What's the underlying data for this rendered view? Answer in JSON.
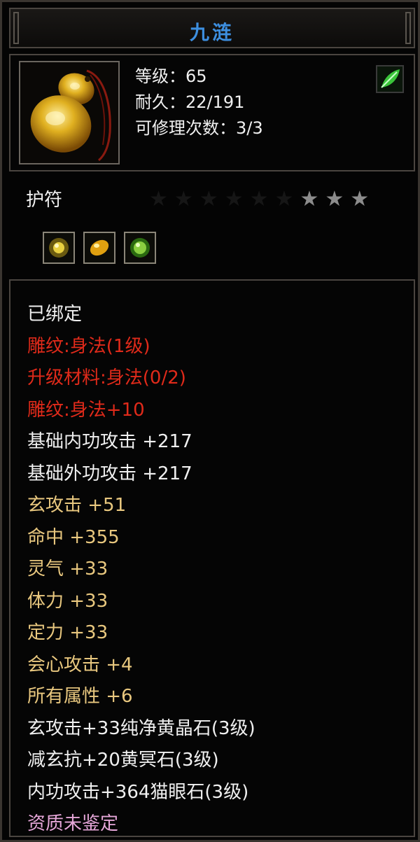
{
  "title": "九涟",
  "item": {
    "level": "等级：65",
    "durability": "耐久：22/191",
    "repairs": "可修理次数：3/3",
    "icon": "amber-gourd-amulet",
    "badge_icon": "green-leaf-icon"
  },
  "item_type": "护符",
  "stars": {
    "total": 9,
    "unlit": 6,
    "lit": 3
  },
  "sockets": [
    "yellow-crystal-gem-icon",
    "amber-stone-gem-icon",
    "green-cat-eye-gem-icon"
  ],
  "colors": {
    "white": "#f0f0f0",
    "red": "#e02a1a",
    "gold": "#e9c87f",
    "pink": "#e5a6d8",
    "title": "#3d8fe0"
  },
  "stats": [
    {
      "text": "已绑定",
      "color": "white"
    },
    {
      "text": "雕纹:身法(1级)",
      "color": "red"
    },
    {
      "text": "升级材料:身法(0/2)",
      "color": "red"
    },
    {
      "text": "雕纹:身法+10",
      "color": "red"
    },
    {
      "text": "基础内功攻击  +217",
      "color": "white"
    },
    {
      "text": "基础外功攻击  +217",
      "color": "white"
    },
    {
      "text": "玄攻击  +51",
      "color": "gold"
    },
    {
      "text": "命中  +355",
      "color": "gold"
    },
    {
      "text": "灵气  +33",
      "color": "gold"
    },
    {
      "text": "体力  +33",
      "color": "gold"
    },
    {
      "text": "定力  +33",
      "color": "gold"
    },
    {
      "text": "会心攻击  +4",
      "color": "gold"
    },
    {
      "text": "所有属性  +6",
      "color": "gold"
    },
    {
      "text": "玄攻击+33纯净黄晶石(3级)",
      "color": "white"
    },
    {
      "text": "减玄抗+20黄冥石(3级)",
      "color": "white"
    },
    {
      "text": "内功攻击+364猫眼石(3级)",
      "color": "white"
    },
    {
      "text": "资质未鉴定",
      "color": "pink"
    }
  ]
}
